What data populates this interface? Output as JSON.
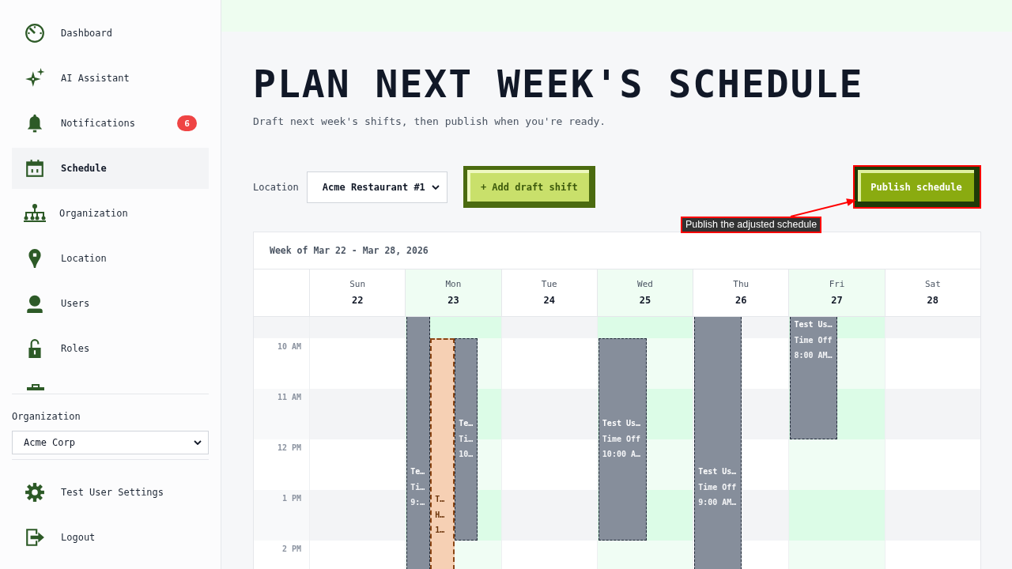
{
  "sidebar": {
    "nav_items": [
      {
        "label": "Dashboard",
        "selected": false
      },
      {
        "label": "AI Assistant",
        "selected": false
      },
      {
        "label": "Notifications",
        "selected": false,
        "badge": "6"
      },
      {
        "label": "Schedule",
        "selected": true
      },
      {
        "label": "Organization",
        "selected": false
      },
      {
        "label": "Location",
        "selected": false
      },
      {
        "label": "Users",
        "selected": false
      },
      {
        "label": "Roles",
        "selected": false
      }
    ],
    "organization": {
      "label": "Organization",
      "value": "Acme Corp"
    },
    "footer_items": [
      {
        "label": "Test User Settings"
      },
      {
        "label": "Logout"
      }
    ]
  },
  "page": {
    "title": "PLAN NEXT WEEK'S SCHEDULE",
    "subtitle": "Draft next week's shifts, then publish when you're ready."
  },
  "toolbar": {
    "location": {
      "label": "Location",
      "value": "Acme Restaurant #1"
    },
    "add_button": "+ Add draft shift",
    "publish_button": {
      "label": "Publish schedule",
      "highlighted": true
    }
  },
  "annotation": {
    "label": "Publish the adjusted schedule"
  },
  "calendar": {
    "week_label": "Week of Mar 22 - Mar 28, 2026",
    "times": [
      "10 AM",
      "11 AM",
      "12 PM",
      "1 PM",
      "2 PM"
    ],
    "days": [
      {
        "name": "Sun",
        "date": "22",
        "tinted": false
      },
      {
        "name": "Mon",
        "date": "23",
        "tinted": true,
        "events": [
          {
            "kind": "time_off",
            "title": "Te…",
            "type": "Ti…",
            "time": "9:…"
          },
          {
            "kind": "shift",
            "title": "T…",
            "type": "H…",
            "time": "1…"
          },
          {
            "kind": "time_off",
            "title": "Te…",
            "type": "Ti…",
            "time": "10…"
          }
        ]
      },
      {
        "name": "Tue",
        "date": "24",
        "tinted": false
      },
      {
        "name": "Wed",
        "date": "25",
        "tinted": true,
        "events": [
          {
            "kind": "time_off",
            "title": "Test Us…",
            "type": "Time Off",
            "time": "10:00 A…"
          }
        ]
      },
      {
        "name": "Thu",
        "date": "26",
        "tinted": false,
        "events": [
          {
            "kind": "time_off",
            "title": "Test Us…",
            "type": "Time Off",
            "time": "9:00 AM…"
          }
        ]
      },
      {
        "name": "Fri",
        "date": "27",
        "tinted": true,
        "events": [
          {
            "kind": "time_off",
            "title": "Test Us…",
            "type": "Time Off",
            "time": "8:00 AM…"
          }
        ]
      },
      {
        "name": "Sat",
        "date": "28",
        "tinted": false
      }
    ]
  }
}
